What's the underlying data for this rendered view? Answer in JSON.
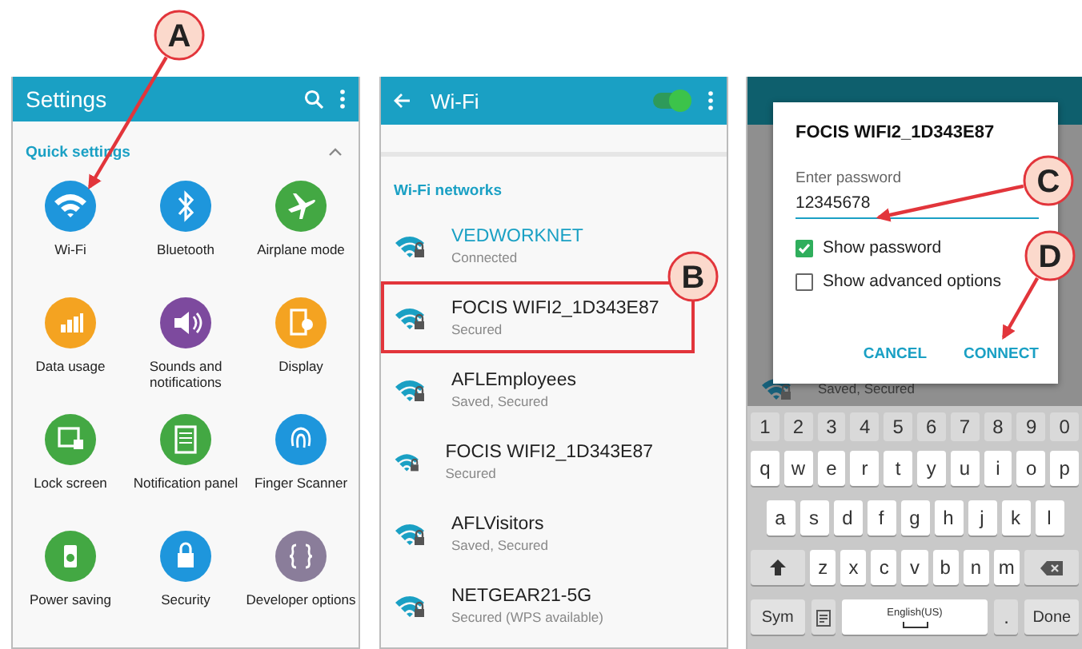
{
  "settings_screen": {
    "title": "Settings",
    "section": "Quick settings",
    "expanded": true,
    "items": [
      {
        "label": "Wi-Fi",
        "color": "#1e96dc"
      },
      {
        "label": "Bluetooth",
        "color": "#1e96dc"
      },
      {
        "label": "Airplane mode",
        "color": "#43a843"
      },
      {
        "label": "Data usage",
        "color": "#f4a321"
      },
      {
        "label": "Sounds and notifications",
        "color": "#7d4a9e"
      },
      {
        "label": "Display",
        "color": "#f4a321"
      },
      {
        "label": "Lock screen",
        "color": "#43a843"
      },
      {
        "label": "Notification panel",
        "color": "#43a843"
      },
      {
        "label": "Finger Scanner",
        "color": "#1e96dc"
      },
      {
        "label": "Power saving",
        "color": "#43a843"
      },
      {
        "label": "Security",
        "color": "#1e96dc"
      },
      {
        "label": "Developer options",
        "color": "#8a7d9a"
      }
    ]
  },
  "wifi_screen": {
    "title": "Wi-Fi",
    "wifi_on": true,
    "section": "Wi-Fi networks",
    "networks": [
      {
        "name": "VEDWORKNET",
        "status": "Connected",
        "connected": true,
        "marked": false
      },
      {
        "name": "FOCIS WIFI2_1D343E87",
        "status": "Secured",
        "connected": false,
        "marked": true
      },
      {
        "name": "AFLEmployees",
        "status": "Saved, Secured",
        "connected": false,
        "marked": false
      },
      {
        "name": "FOCIS WIFI2_1D343E87",
        "status": "Secured",
        "connected": false,
        "marked": false
      },
      {
        "name": "AFLVisitors",
        "status": "Saved, Secured",
        "connected": false,
        "marked": false
      },
      {
        "name": "NETGEAR21-5G",
        "status": "Secured (WPS available)",
        "connected": false,
        "marked": false
      }
    ]
  },
  "password_screen": {
    "background_status": "Saved, Secured",
    "dialog": {
      "title": "FOCIS WIFI2_1D343E87",
      "label": "Enter password",
      "value": "12345678",
      "options": [
        {
          "label": "Show password",
          "checked": true
        },
        {
          "label": "Show advanced options",
          "checked": false
        }
      ],
      "buttons": [
        "CANCEL",
        "CONNECT"
      ]
    },
    "keyboard": {
      "rows": [
        {
          "keys": [
            {
              "kind": "number",
              "label": "1"
            },
            {
              "kind": "number",
              "label": "2"
            },
            {
              "kind": "number",
              "label": "3"
            },
            {
              "kind": "number",
              "label": "4"
            },
            {
              "kind": "number",
              "label": "5"
            },
            {
              "kind": "number",
              "label": "6"
            },
            {
              "kind": "number",
              "label": "7"
            },
            {
              "kind": "number",
              "label": "8"
            },
            {
              "kind": "number",
              "label": "9"
            },
            {
              "kind": "number",
              "label": "0"
            }
          ]
        },
        {
          "keys": [
            {
              "kind": "char",
              "label": "q"
            },
            {
              "kind": "char",
              "label": "w"
            },
            {
              "kind": "char",
              "label": "e"
            },
            {
              "kind": "char",
              "label": "r"
            },
            {
              "kind": "char",
              "label": "t"
            },
            {
              "kind": "char",
              "label": "y"
            },
            {
              "kind": "char",
              "label": "u"
            },
            {
              "kind": "char",
              "label": "i"
            },
            {
              "kind": "char",
              "label": "o"
            },
            {
              "kind": "char",
              "label": "p"
            }
          ]
        },
        {
          "keys": [
            {
              "kind": "char",
              "label": "a"
            },
            {
              "kind": "char",
              "label": "s"
            },
            {
              "kind": "char",
              "label": "d"
            },
            {
              "kind": "char",
              "label": "f"
            },
            {
              "kind": "char",
              "label": "g"
            },
            {
              "kind": "char",
              "label": "h"
            },
            {
              "kind": "char",
              "label": "j"
            },
            {
              "kind": "char",
              "label": "k"
            },
            {
              "kind": "char",
              "label": "l"
            }
          ]
        },
        {
          "keys": [
            {
              "kind": "shift"
            },
            {
              "kind": "char",
              "label": "z"
            },
            {
              "kind": "char",
              "label": "x"
            },
            {
              "kind": "char",
              "label": "c"
            },
            {
              "kind": "char",
              "label": "v"
            },
            {
              "kind": "char",
              "label": "b"
            },
            {
              "kind": "char",
              "label": "n"
            },
            {
              "kind": "char",
              "label": "m"
            },
            {
              "kind": "backspace"
            }
          ]
        },
        {
          "keys": [
            {
              "kind": "function",
              "label": "Sym"
            },
            {
              "kind": "clipboard"
            },
            {
              "kind": "space",
              "label": "English(US)"
            },
            {
              "kind": "period",
              "label": "."
            },
            {
              "kind": "function",
              "label": "Done"
            }
          ]
        }
      ]
    }
  },
  "callouts": [
    {
      "label": "A"
    },
    {
      "label": "B"
    },
    {
      "label": "C"
    },
    {
      "label": "D"
    }
  ]
}
